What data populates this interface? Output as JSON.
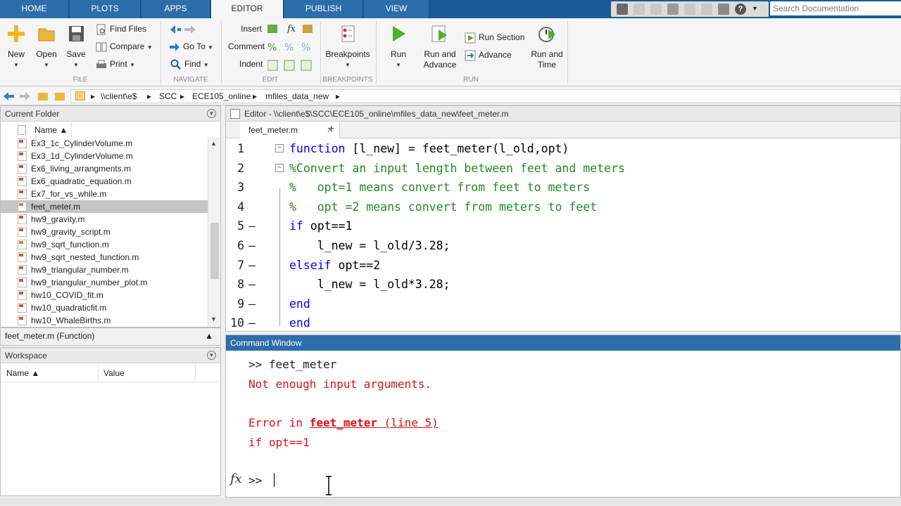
{
  "ribbon_tabs": [
    "HOME",
    "PLOTS",
    "APPS",
    "EDITOR",
    "PUBLISH",
    "VIEW"
  ],
  "active_tab": "EDITOR",
  "search_placeholder": "Search Documentation",
  "ribbon": {
    "file": {
      "new": "New",
      "open": "Open",
      "save": "Save",
      "find_files": "Find Files",
      "compare": "Compare",
      "print": "Print",
      "section": "FILE"
    },
    "navigate": {
      "go_to": "Go To",
      "find": "Find",
      "section": "NAVIGATE"
    },
    "edit": {
      "insert": "Insert",
      "comment": "Comment",
      "indent": "Indent",
      "section": "EDIT"
    },
    "breakpoints": {
      "label": "Breakpoints",
      "section": "BREAKPOINTS"
    },
    "run": {
      "run": "Run",
      "run_and_advance_1": "Run and",
      "run_and_advance_2": "Advance",
      "run_section": "Run Section",
      "advance": "Advance",
      "run_and_time_1": "Run and",
      "run_and_time_2": "Time",
      "section": "RUN"
    }
  },
  "path": [
    "\\\\client\\e$",
    "SCC",
    "ECE105_online",
    "mfiles_data_new"
  ],
  "current_folder": {
    "title": "Current Folder",
    "name_col": "Name ▲",
    "files": [
      {
        "name": "Ex3_1c_CylinderVolume.m",
        "type": "script"
      },
      {
        "name": "Ex3_1d_CylinderVolume.m",
        "type": "script"
      },
      {
        "name": "Ex6_living_arrangments.m",
        "type": "script"
      },
      {
        "name": "Ex6_quadratic_equation.m",
        "type": "script"
      },
      {
        "name": "Ex7_for_vs_while.m",
        "type": "script"
      },
      {
        "name": "feet_meter.m",
        "type": "function",
        "selected": true
      },
      {
        "name": "hw9_gravity.m",
        "type": "script"
      },
      {
        "name": "hw9_gravity_script.m",
        "type": "script"
      },
      {
        "name": "hw9_sqrt_function.m",
        "type": "function"
      },
      {
        "name": "hw9_sqrt_nested_function.m",
        "type": "script"
      },
      {
        "name": "hw9_triangular_number.m",
        "type": "script"
      },
      {
        "name": "hw9_triangular_number_plot.m",
        "type": "script"
      },
      {
        "name": "hw10_COVID_fit.m",
        "type": "script"
      },
      {
        "name": "hw10_quadraticfit.m",
        "type": "script"
      },
      {
        "name": "hw10_WhaleBirths.m",
        "type": "script"
      }
    ]
  },
  "details": "feet_meter.m  (Function)",
  "workspace": {
    "title": "Workspace",
    "name_col": "Name ▲",
    "value_col": "Value"
  },
  "editor": {
    "title": "Editor - \\\\client\\e$\\SCC\\ECE105_online\\mfiles_data_new\\feet_meter.m",
    "tab": "feet_meter.m",
    "lines": [
      {
        "n": "1",
        "parts": [
          {
            "t": "function",
            "c": "kw"
          },
          {
            "t": " [l_new] = feet_meter(l_old,opt)",
            "c": "pl"
          }
        ]
      },
      {
        "n": "2",
        "parts": [
          {
            "t": "%Convert an input length between feet and meters",
            "c": "cm"
          }
        ]
      },
      {
        "n": "3",
        "parts": [
          {
            "t": "%   opt=1 means convert from feet to meters",
            "c": "cm"
          }
        ]
      },
      {
        "n": "4",
        "parts": [
          {
            "t": "%   opt =2 means convert from meters to feet",
            "c": "cm"
          }
        ]
      },
      {
        "n": "5",
        "parts": [
          {
            "t": "if",
            "c": "kw"
          },
          {
            "t": " opt==1",
            "c": "pl"
          }
        ]
      },
      {
        "n": "6",
        "parts": [
          {
            "t": "    l_new = l_old/3.28;",
            "c": "pl"
          }
        ]
      },
      {
        "n": "7",
        "parts": [
          {
            "t": "elseif",
            "c": "kw"
          },
          {
            "t": " opt==2",
            "c": "pl"
          }
        ]
      },
      {
        "n": "8",
        "parts": [
          {
            "t": "    l_new = l_old*3.28;",
            "c": "pl"
          }
        ]
      },
      {
        "n": "9",
        "parts": [
          {
            "t": "end",
            "c": "kw"
          }
        ]
      },
      {
        "n": "10",
        "parts": [
          {
            "t": "end",
            "c": "kw"
          }
        ]
      }
    ]
  },
  "command_window": {
    "title": "Command Window",
    "line1": ">> feet_meter",
    "line2": "Not enough input arguments.",
    "err_prefix": "Error in ",
    "err_func": "feet_meter",
    "err_line": " (line 5)",
    "line4": "if opt==1",
    "prompt": ">>"
  }
}
